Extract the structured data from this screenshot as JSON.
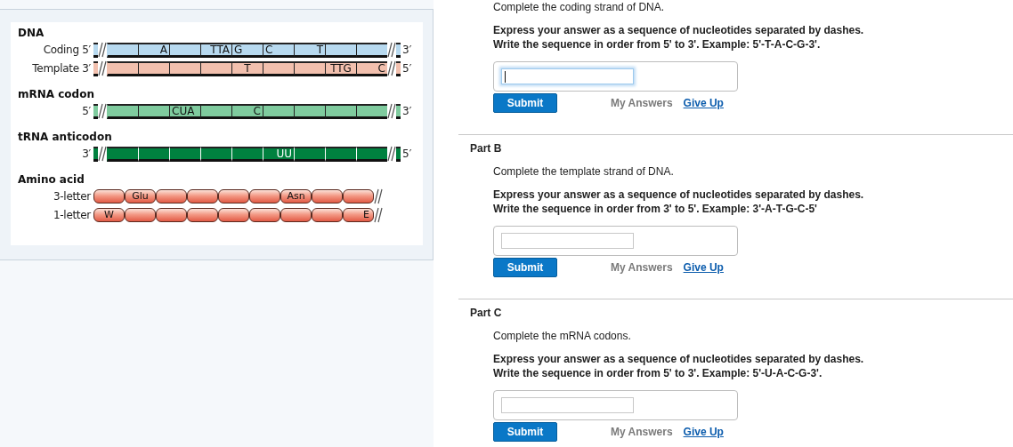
{
  "diagram": {
    "sections": [
      {
        "title": "DNA",
        "strands": [
          {
            "kind": "coding",
            "label": "Coding 5′",
            "end": "3′",
            "cells": [
              {},
              {
                "text": "A",
                "kind": "right"
              },
              {},
              {
                "text": "TTA",
                "kind": "right"
              },
              {
                "text": "G",
                "kind": "left"
              },
              {
                "text": "C",
                "kind": "left"
              },
              {
                "text": "T",
                "kind": "right"
              },
              {},
              {}
            ]
          },
          {
            "kind": "template",
            "label": "Template 3′",
            "end": "5′",
            "cells": [
              {},
              {},
              {},
              {},
              {
                "text": "T",
                "kind": "center"
              },
              {},
              {},
              {
                "text": "TTG",
                "kind": "center"
              },
              {
                "text": "C",
                "kind": "right"
              }
            ]
          }
        ]
      },
      {
        "title": "mRNA codon",
        "strands": [
          {
            "kind": "mrna",
            "label": "5′",
            "end": "3′",
            "cells": [
              {},
              {},
              {
                "text": "CUA",
                "kind": "left"
              },
              {},
              {
                "text": "C",
                "kind": "right"
              },
              {},
              {},
              {},
              {}
            ]
          }
        ]
      },
      {
        "title": "tRNA anticodon",
        "strands": [
          {
            "kind": "trna",
            "label": "3′",
            "end": "5′",
            "cells": [
              {},
              {},
              {},
              {},
              {},
              {
                "text": "UU",
                "kind": "right"
              },
              {},
              {},
              {}
            ]
          }
        ]
      },
      {
        "title": "Amino acid",
        "strands": [
          {
            "kind": "amino",
            "label": "3-letter",
            "cells": [
              {},
              {
                "text": "Glu",
                "kind": "center"
              },
              {},
              {},
              {},
              {},
              {
                "text": "Asn",
                "kind": "center"
              },
              {},
              {}
            ]
          },
          {
            "kind": "amino",
            "label": "1-letter",
            "cells": [
              {
                "text": "W",
                "kind": "center"
              },
              {},
              {},
              {},
              {},
              {},
              {},
              {},
              {
                "text": "E",
                "kind": "right"
              }
            ]
          }
        ]
      }
    ]
  },
  "parts": [
    {
      "prompt": "Complete the coding strand of DNA.",
      "instructions": [
        "Express your answer as a sequence of nucleotides separated by dashes.",
        "Write the sequence in order from 5' to 3'. Example: 5'-T-A-C-G-3'."
      ],
      "answer": {
        "focused": true
      },
      "submit": "Submit",
      "my_answers": "My Answers",
      "give_up": "Give Up"
    },
    {
      "title": "Part B",
      "prompt": "Complete the template strand of DNA.",
      "instructions": [
        "Express your answer as a sequence of nucleotides separated by dashes.",
        "Write the sequence in order from 3' to 5'. Example: 3'-A-T-G-C-5'"
      ],
      "answer": {
        "focused": false
      },
      "submit": "Submit",
      "my_answers": "My Answers",
      "give_up": "Give Up"
    },
    {
      "title": "Part C",
      "prompt": "Complete the mRNA codons.",
      "instructions": [
        "Express your answer as a sequence of nucleotides separated by dashes.",
        "Write the sequence in order from 5' to 3'. Example: 5'-U-A-C-G-3'."
      ],
      "answer": {
        "focused": false
      },
      "submit": "Submit",
      "my_answers": "My Answers",
      "give_up": "Give Up"
    }
  ]
}
